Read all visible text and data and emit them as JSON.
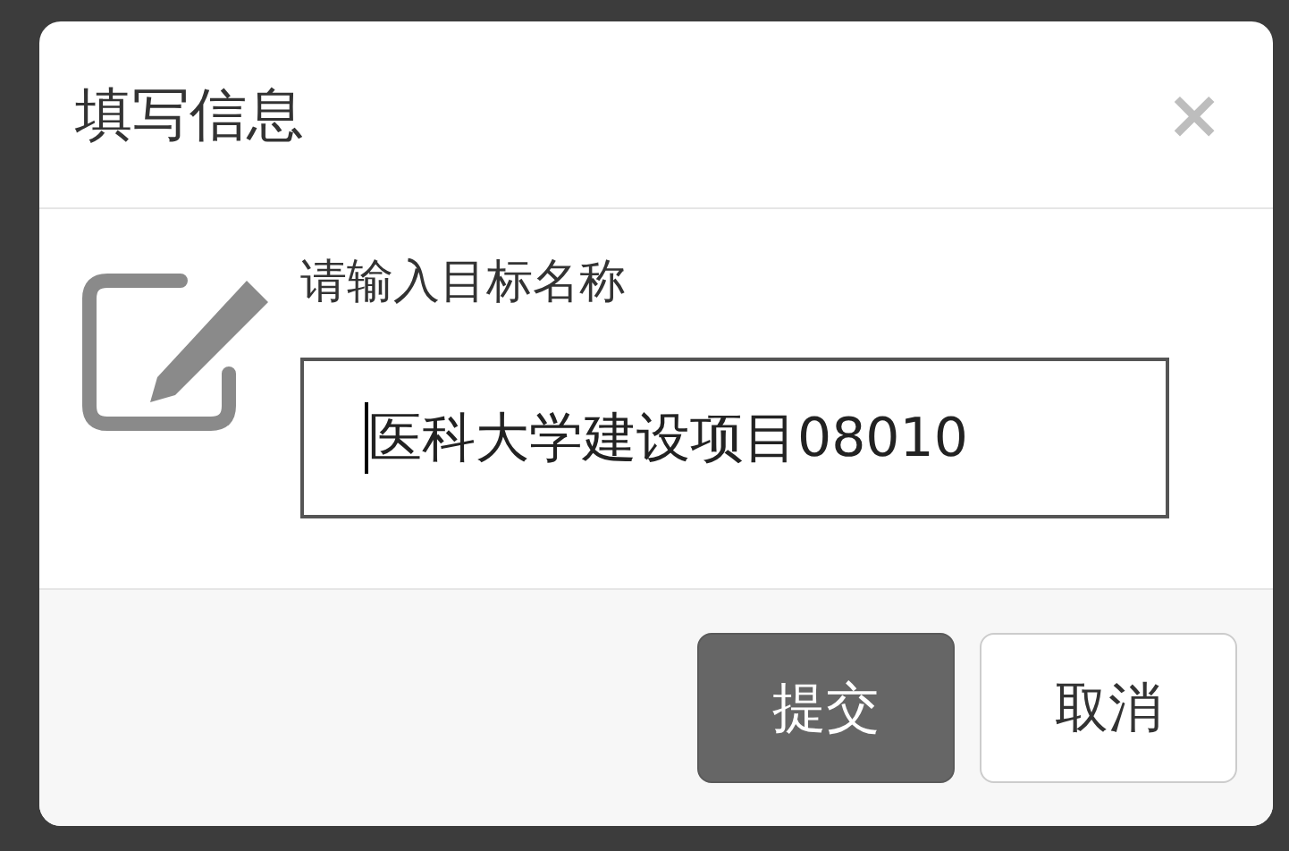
{
  "dialog": {
    "title": "填写信息",
    "close": "×",
    "prompt": "请输入目标名称",
    "input": {
      "value": "医科大学建设项目08010"
    },
    "buttons": [
      {
        "label": "提交",
        "kind": "primary"
      },
      {
        "label": "取消",
        "kind": "default"
      }
    ]
  }
}
